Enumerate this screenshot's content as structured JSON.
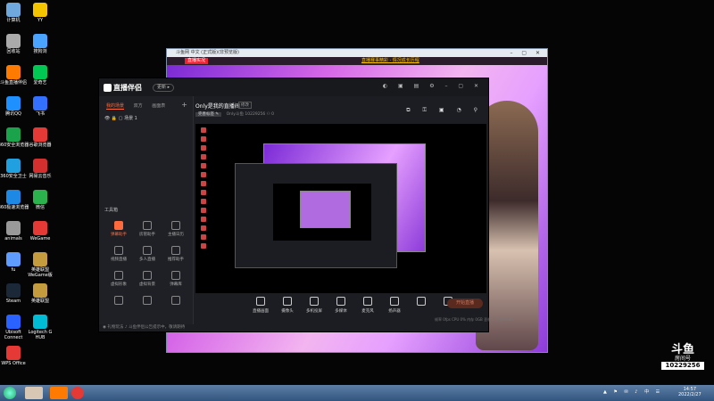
{
  "desktop": {
    "icons": [
      {
        "label": "计算机",
        "color": "#6fa8dc",
        "col": 0,
        "row": 0
      },
      {
        "label": "YY",
        "color": "#f5c400",
        "col": 1,
        "row": 0
      },
      {
        "label": "回收站",
        "color": "#aaaaaa",
        "col": 0,
        "row": 1
      },
      {
        "label": "搜狗浏",
        "color": "#4aa3ff",
        "col": 1,
        "row": 1
      },
      {
        "label": "斗鱼直播伴侣",
        "color": "#ff7a00",
        "col": 0,
        "row": 2
      },
      {
        "label": "爱奇艺",
        "color": "#00c853",
        "col": 1,
        "row": 2
      },
      {
        "label": "腾讯QQ",
        "color": "#1e90ff",
        "col": 0,
        "row": 3
      },
      {
        "label": "飞书",
        "color": "#3370ff",
        "col": 1,
        "row": 3
      },
      {
        "label": "360安全浏览器",
        "color": "#1aa34a",
        "col": 0,
        "row": 4
      },
      {
        "label": "谷歌浏览器",
        "color": "#e53935",
        "col": 1,
        "row": 4
      },
      {
        "label": "360安全卫士",
        "color": "#21a0e0",
        "col": 0,
        "row": 5
      },
      {
        "label": "网易云音乐",
        "color": "#d32f2f",
        "col": 1,
        "row": 5
      },
      {
        "label": "360极速浏览器",
        "color": "#1e88e5",
        "col": 0,
        "row": 6
      },
      {
        "label": "微信",
        "color": "#2bb24c",
        "col": 1,
        "row": 6
      },
      {
        "label": "animals",
        "color": "#999999",
        "col": 0,
        "row": 7
      },
      {
        "label": "WeGame",
        "color": "#e53935",
        "col": 1,
        "row": 7
      },
      {
        "label": "fu",
        "color": "#5e9cff",
        "col": 0,
        "row": 8
      },
      {
        "label": "英雄联盟WeGame版",
        "color": "#c49b3d",
        "col": 1,
        "row": 8
      },
      {
        "label": "Steam",
        "color": "#1b2838",
        "col": 0,
        "row": 9
      },
      {
        "label": "英雄联盟",
        "color": "#c49b3d",
        "col": 1,
        "row": 9
      },
      {
        "label": "Ubisoft Connect",
        "color": "#2962ff",
        "col": 0,
        "row": 10
      },
      {
        "label": "Logitech G HUB",
        "color": "#00bcd4",
        "col": 1,
        "row": 10
      },
      {
        "label": "WPS Office",
        "color": "#e53935",
        "col": 0,
        "row": 11
      }
    ]
  },
  "browser": {
    "title": "斗鱼网 中文 (正式版)(非预览版)",
    "badge": "直播实况",
    "links": "直播赛事精彩 · 情况成长历程",
    "controls": "– ▢ ✕",
    "logo": "斗鱼"
  },
  "app": {
    "brand": "直播伴侣",
    "version_btn": "更新 ▸",
    "window_controls": "◐ ▣ ▤ ⚙ – ▢ ✕",
    "side_tabs": [
      "我的场景",
      "双方",
      "画面表"
    ],
    "add_scene": "+",
    "scene_item": "场景 1",
    "toolbox_title": "工具箱",
    "tools": [
      {
        "label": "弹幕助手",
        "hot": true
      },
      {
        "label": "房管助手",
        "hot": false
      },
      {
        "label": "主播日历",
        "hot": false
      },
      {
        "label": "视频直播",
        "hot": false
      },
      {
        "label": "多人直播",
        "hot": false
      },
      {
        "label": "推荐助手",
        "hot": false
      },
      {
        "label": "虚拟形象",
        "hot": false
      },
      {
        "label": "虚拟背景",
        "hot": false
      },
      {
        "label": "弹幕库",
        "hot": false
      },
      {
        "label": "",
        "hot": false
      },
      {
        "label": "",
        "hot": false
      },
      {
        "label": "",
        "hot": false
      }
    ],
    "room_title": "Only是我的直播间",
    "change_btn": "修改",
    "meta_pill": "完善标签 ✎",
    "meta_text": "Only斗鱼 10229256 ⚇ 0",
    "top_icons": "⧉ ⚿ ▣ ◔ ⚲",
    "bottom_tools": [
      {
        "label": "直播画面"
      },
      {
        "label": "摄像头"
      },
      {
        "label": "多机投屏"
      },
      {
        "label": "多媒体"
      },
      {
        "label": "麦克风"
      },
      {
        "label": "扬声器"
      },
      {
        "label": ""
      },
      {
        "label": ""
      }
    ],
    "go_live": "开始直播",
    "stats": "帧率 0fps  CPU 0%  内存 0GB  丢帧 0  上行 0KB/s",
    "notice": "◉ 礼物玩法    ♪ 斗鱼伴侣公告提示中，敬请期待"
  },
  "douyu_badge": {
    "logo": "斗鱼",
    "room_label": "房间号",
    "room_number": "10229256"
  },
  "taskbar": {
    "tray": "▲ ⚑ ✉ ♪ 中 ☰",
    "time": "14:57",
    "date": "2022/2/27"
  }
}
